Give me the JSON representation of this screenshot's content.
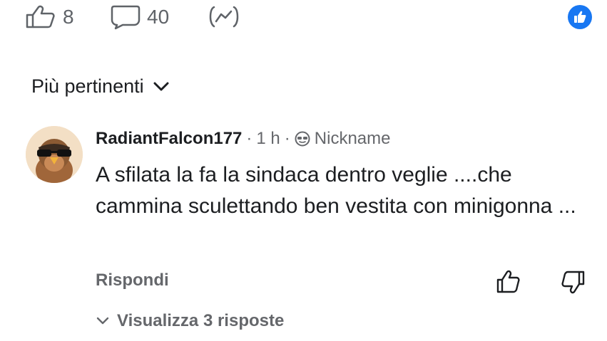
{
  "stats": {
    "likes": "8",
    "comments": "40",
    "share_icon": "share-chart-icon"
  },
  "sort": {
    "label": "Più pertinenti"
  },
  "comment": {
    "author": "RadiantFalcon177",
    "time": "1 h",
    "badge": "Nickname",
    "text": "A sfilata la fa la sindaca dentro veglie ....che cammina sculettando ben vestita con minigonna ...",
    "reply_label": "Rispondi",
    "view_replies_label": "Visualizza 3 risposte"
  },
  "colors": {
    "brand_blue": "#1877f2",
    "muted_text": "#65676b",
    "primary_text": "#1c1e21"
  }
}
